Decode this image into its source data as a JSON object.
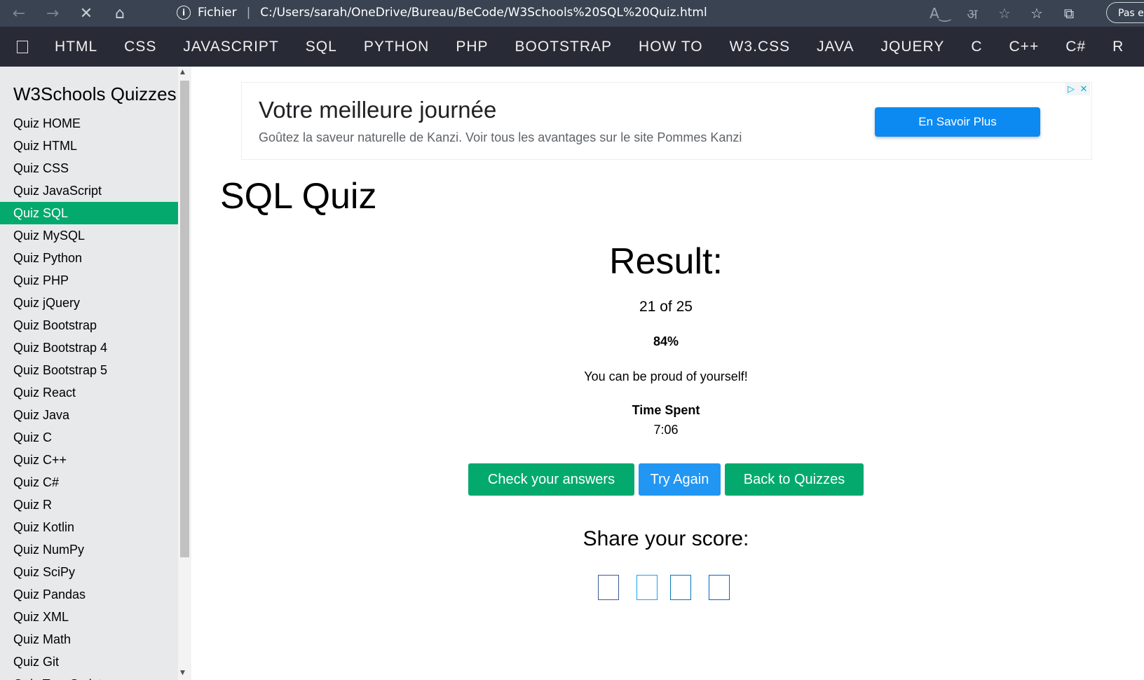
{
  "browser": {
    "address_prefix": "Fichier",
    "url": "C:/Users/sarah/OneDrive/Bureau/BeCode/W3Schools%20SQL%20Quiz.html",
    "profile_label": "Pas en"
  },
  "topnav": {
    "items": [
      "HTML",
      "CSS",
      "JAVASCRIPT",
      "SQL",
      "PYTHON",
      "PHP",
      "BOOTSTRAP",
      "HOW TO",
      "W3.CSS",
      "JAVA",
      "JQUERY",
      "C",
      "C++",
      "C#",
      "R"
    ]
  },
  "sidebar": {
    "title": "W3Schools Quizzes",
    "items": [
      {
        "label": "Quiz HOME"
      },
      {
        "label": "Quiz HTML"
      },
      {
        "label": "Quiz CSS"
      },
      {
        "label": "Quiz JavaScript"
      },
      {
        "label": "Quiz SQL",
        "active": true
      },
      {
        "label": "Quiz MySQL"
      },
      {
        "label": "Quiz Python"
      },
      {
        "label": "Quiz PHP"
      },
      {
        "label": "Quiz jQuery"
      },
      {
        "label": "Quiz Bootstrap"
      },
      {
        "label": "Quiz Bootstrap 4"
      },
      {
        "label": "Quiz Bootstrap 5"
      },
      {
        "label": "Quiz React"
      },
      {
        "label": "Quiz Java"
      },
      {
        "label": "Quiz C"
      },
      {
        "label": "Quiz C++"
      },
      {
        "label": "Quiz C#"
      },
      {
        "label": "Quiz R"
      },
      {
        "label": "Quiz Kotlin"
      },
      {
        "label": "Quiz NumPy"
      },
      {
        "label": "Quiz SciPy"
      },
      {
        "label": "Quiz Pandas"
      },
      {
        "label": "Quiz XML"
      },
      {
        "label": "Quiz Math"
      },
      {
        "label": "Quiz Git"
      },
      {
        "label": "Quiz TypeScript"
      }
    ]
  },
  "ad": {
    "headline": "Votre meilleure journée",
    "body": "Goûtez la saveur naturelle de Kanzi. Voir tous les avantages sur le site Pommes Kanzi",
    "cta": "En Savoir Plus"
  },
  "main": {
    "page_title": "SQL Quiz",
    "result_heading": "Result:",
    "score": "21 of 25",
    "percent": "84%",
    "message": "You can be proud of yourself!",
    "time_label": "Time Spent",
    "time_value": "7:06",
    "buttons": {
      "check": "Check your answers",
      "try_again": "Try Again",
      "back": "Back to Quizzes"
    },
    "share_heading": "Share your score:"
  },
  "colors": {
    "accent_green": "#04aa6d",
    "button_blue": "#2196f3",
    "nav_dark": "#282a35",
    "share_icons": [
      "#3b5998",
      "#1da1f2",
      "#0077b5",
      "#0a66c2"
    ]
  }
}
